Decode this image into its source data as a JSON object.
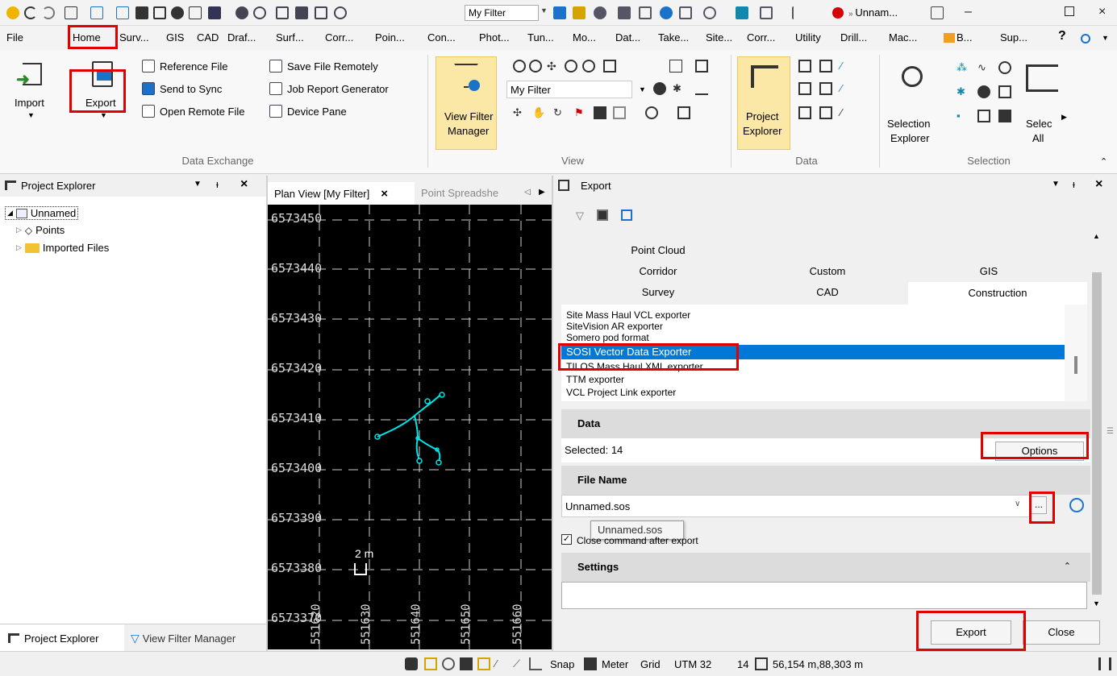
{
  "window": {
    "title": "Unnam...",
    "filter_value": "My Filter",
    "colors": {
      "accent": "#0066cc",
      "highlight": "#e00000",
      "selection": "#0078d7",
      "canvas": "#000000",
      "lines": "#00e5e5"
    }
  },
  "menu": {
    "tabs": [
      "File",
      "Home",
      "Surv...",
      "GIS",
      "CAD",
      "Draf...",
      "Surf...",
      "Corr...",
      "Poin...",
      "Con...",
      "Phot...",
      "Tun...",
      "Mo...",
      "Dat...",
      "Take...",
      "Site...",
      "Corr...",
      "Utility",
      "Drill...",
      "Mac...",
      "B...",
      "Sup..."
    ],
    "help": "?"
  },
  "ribbon": {
    "data_exchange": {
      "import_label": "Import",
      "export_label": "Export",
      "reference_file": "Reference File",
      "send_to_sync": "Send to Sync",
      "open_remote_file": "Open Remote File",
      "save_file_remotely": "Save File Remotely",
      "job_report_generator": "Job Report Generator",
      "device_pane": "Device Pane",
      "group_label": "Data Exchange"
    },
    "view": {
      "view_filter_manager_1": "View Filter",
      "view_filter_manager_2": "Manager",
      "filter_value": "My Filter",
      "group_label": "View"
    },
    "data": {
      "project_explorer_1": "Project",
      "project_explorer_2": "Explorer",
      "group_label": "Data"
    },
    "selection": {
      "selection_explorer_1": "Selection",
      "selection_explorer_2": "Explorer",
      "select_all_1": "Selec",
      "select_all_2": "All",
      "group_label": "Selection"
    }
  },
  "project_explorer": {
    "title": "Project Explorer",
    "items": [
      "Unnamed",
      "Points",
      "Imported Files"
    ],
    "bottom_tabs": [
      "Project Explorer",
      "View Filter Manager"
    ]
  },
  "plan_view": {
    "tab_label": "Plan View [My Filter]",
    "tab2_label": "Point Spreadshe",
    "y_labels": [
      "6573450",
      "6573440",
      "6573430",
      "6573420",
      "6573410",
      "6573400",
      "6573390",
      "6573380",
      "6573370"
    ],
    "x_labels": [
      "551620",
      "551630",
      "551640",
      "551650",
      "551660"
    ],
    "scale_label": "2 m"
  },
  "export_panel": {
    "title": "Export",
    "category_tabs": {
      "row1": [
        "Point Cloud"
      ],
      "row2": [
        "Corridor",
        "Custom",
        "GIS"
      ],
      "row3": [
        "Survey",
        "CAD",
        "Construction"
      ]
    },
    "exporters": [
      "Site Mass Haul VCL exporter",
      "SiteVision AR exporter",
      "Somero pod format",
      "SOSI Vector Data Exporter",
      "TILOS Mass Haul XML exporter",
      "TTM exporter",
      "VCL Project Link exporter"
    ],
    "selected_exporter": "SOSI Vector Data Exporter",
    "data_section": "Data",
    "selected_count": "Selected: 14",
    "options_button": "Options",
    "file_name_section": "File Name",
    "file_name_value": "Unnamed.sos",
    "browse_button": "...",
    "tooltip": "Unnamed.sos",
    "close_after_export": "Close command after export",
    "settings_section": "Settings",
    "export_button": "Export",
    "close_button": "Close"
  },
  "status_bar": {
    "snap": "Snap",
    "meter": "Meter",
    "grid": "Grid",
    "zone": "UTM 32",
    "count": "14",
    "coords": "56,154 m,88,303 m"
  }
}
